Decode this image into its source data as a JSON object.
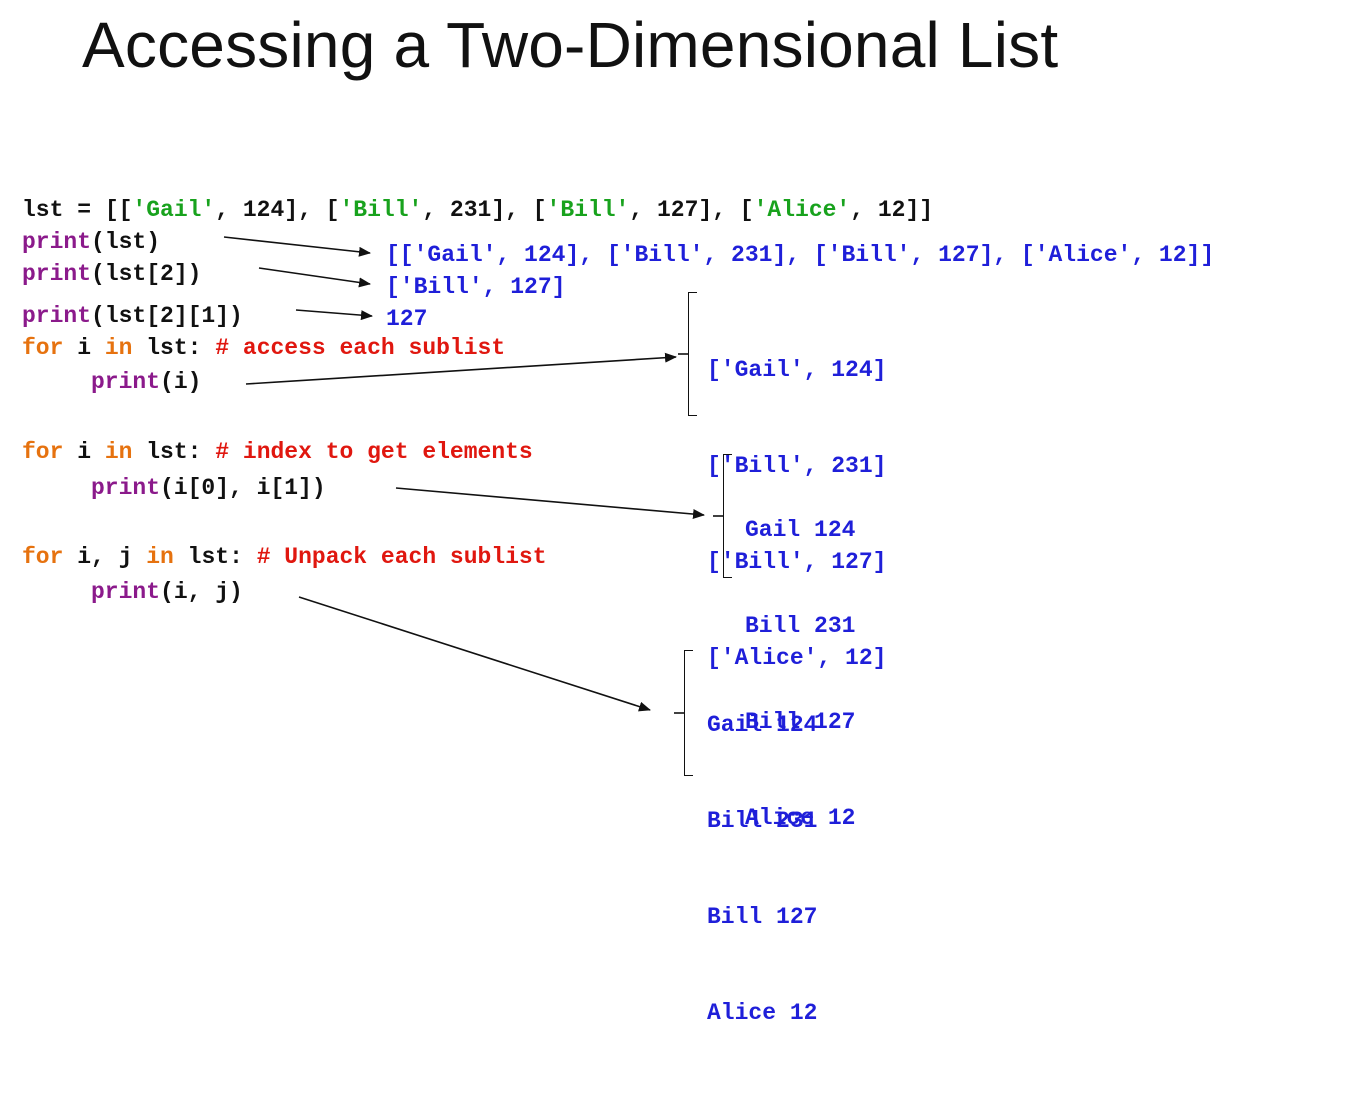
{
  "title": "Accessing a Two-Dimensional List",
  "code": {
    "l1": {
      "a": "lst = [[",
      "b": "'Gail'",
      "c": ", 124], [",
      "d": "'Bill'",
      "e": ", 231], [",
      "f": "'Bill'",
      "g": ", 127], [",
      "h": "'Alice'",
      "i": ", 12]]"
    },
    "l2": {
      "a": "print",
      "b": "(lst)"
    },
    "l3": {
      "a": "print",
      "b": "(lst[2])"
    },
    "l4": {
      "a": "print",
      "b": "(lst[2][1])"
    },
    "l5": {
      "a": "for",
      "b": " i ",
      "c": "in",
      "d": " lst: ",
      "e": "# access each sublist"
    },
    "l6": {
      "a": "print",
      "b": "(i)"
    },
    "l7": {
      "a": "for",
      "b": " i ",
      "c": "in",
      "d": " lst: ",
      "e": "# index to get elements"
    },
    "l8": {
      "a": "print",
      "b": "(i[0], i[1])"
    },
    "l9": {
      "a": "for",
      "b": " i, j ",
      "c": "in",
      "d": " lst: ",
      "e": "# Unpack each sublist"
    },
    "l10": {
      "a": "print",
      "b": "(i, j)"
    }
  },
  "outputs": {
    "full_list": "[['Gail', 124], ['Bill', 231], ['Bill', 127], ['Alice', 12]]",
    "sublist": "['Bill', 127]",
    "element": "127",
    "sublists": [
      "['Gail', 124]",
      "['Bill', 231]",
      "['Bill', 127]",
      "['Alice', 12]"
    ],
    "indexed": [
      "Gail 124",
      "Bill 231",
      "Bill 127",
      "Alice 12"
    ],
    "unpacked": [
      "Gail 124",
      "Bill 231",
      "Bill 127",
      "Alice 12"
    ]
  },
  "colors": {
    "output": "#1f1fd9",
    "function": "#8b1a8b",
    "keyword": "#e6720f",
    "comment": "#e0170f",
    "string": "#18a21d"
  }
}
